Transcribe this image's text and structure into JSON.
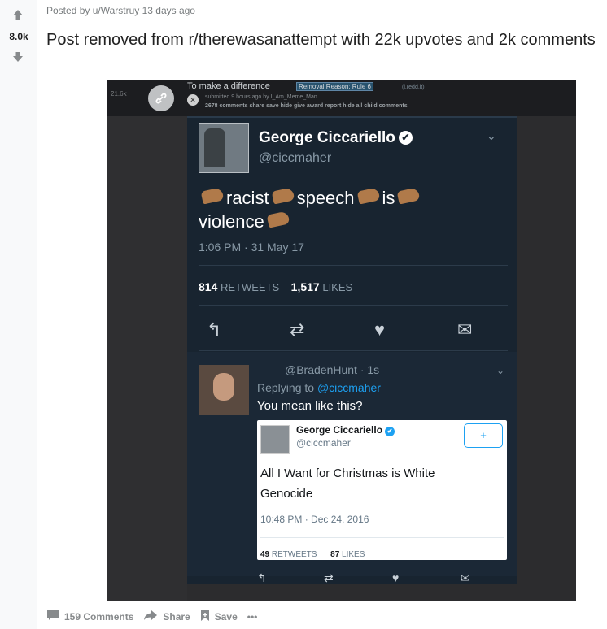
{
  "post": {
    "score": "8.0k",
    "meta": "Posted by u/Warstruy 13 days ago",
    "title": "Post removed from r/therewasanattempt with 22k upvotes and 2k comments"
  },
  "image": {
    "old_reddit": {
      "score": "21.6k",
      "title": "To make a difference",
      "flair": "Removal Reason: Rule 6",
      "domain": "(i.redd.it)",
      "submitted": "submitted 9 hours ago by I_Am_Meme_Man",
      "actions": "2678 comments   share   save   hide   give award   report   hide all child comments"
    },
    "tweet": {
      "name": "George Ciccariello",
      "handle": "@ciccmaher",
      "body_words": [
        "racist",
        "speech",
        "is",
        "violence"
      ],
      "time": "1:06 PM · 31 May 17",
      "retweets_count": "814",
      "retweets_label": "RETWEETS",
      "likes_count": "1,517",
      "likes_label": "LIKES"
    },
    "reply": {
      "handle_time": "@BradenHunt · 1s",
      "replying_prefix": "Replying to",
      "replying_to": "@ciccmaher",
      "text": "You mean like this?"
    },
    "quoted": {
      "name": "George Ciccariello",
      "handle": "@ciccmaher",
      "body": "All I Want for Christmas is White Genocide",
      "time": "10:48 PM · Dec 24, 2016",
      "retweets_count": "49",
      "retweets_label": "RETWEETS",
      "likes_count": "87",
      "likes_label": "LIKES"
    }
  },
  "footer": {
    "comments": "159 Comments",
    "share": "Share",
    "save": "Save",
    "more": "•••"
  },
  "colors": {
    "tweet_bg": "#182430",
    "twitter_blue": "#1da1f2",
    "reddit_meta": "#787c7e"
  },
  "icons": [
    "upvote-icon",
    "downvote-icon",
    "link-icon",
    "close-icon",
    "verified-icon",
    "chevron-down-icon",
    "reply-icon",
    "retweet-icon",
    "like-icon",
    "dm-icon",
    "follow-icon",
    "comment-icon",
    "share-icon",
    "save-icon",
    "more-icon"
  ]
}
